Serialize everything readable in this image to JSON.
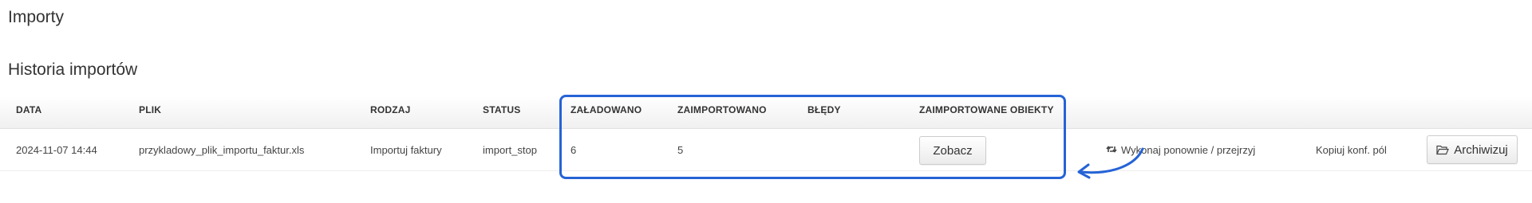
{
  "page": {
    "title": "Importy"
  },
  "history": {
    "title": "Historia importów",
    "columns": {
      "date": "DATA",
      "file": "PLIK",
      "type": "RODZAJ",
      "status": "STATUS",
      "loaded": "ZAŁADOWANO",
      "imported": "ZAIMPORTOWANO",
      "errors": "BŁĘDY",
      "imported_objects": "ZAIMPORTOWANE OBIEKTY"
    },
    "rows": [
      {
        "date": "2024-11-07 14:44",
        "file": "przykladowy_plik_importu_faktur.xls",
        "type": "Importuj faktury",
        "status": "import_stop",
        "loaded": "6",
        "imported": "5",
        "errors": "",
        "view_label": "Zobacz",
        "rerun_label": "Wykonaj ponownie / przejrzyj",
        "copy_label": "Kopiuj konf. pól",
        "archive_label": "Archiwizuj"
      }
    ]
  },
  "icons": {
    "rerun": "retweet-icon",
    "archive": "folder-open-icon"
  },
  "colors": {
    "highlight": "#2563d6"
  }
}
